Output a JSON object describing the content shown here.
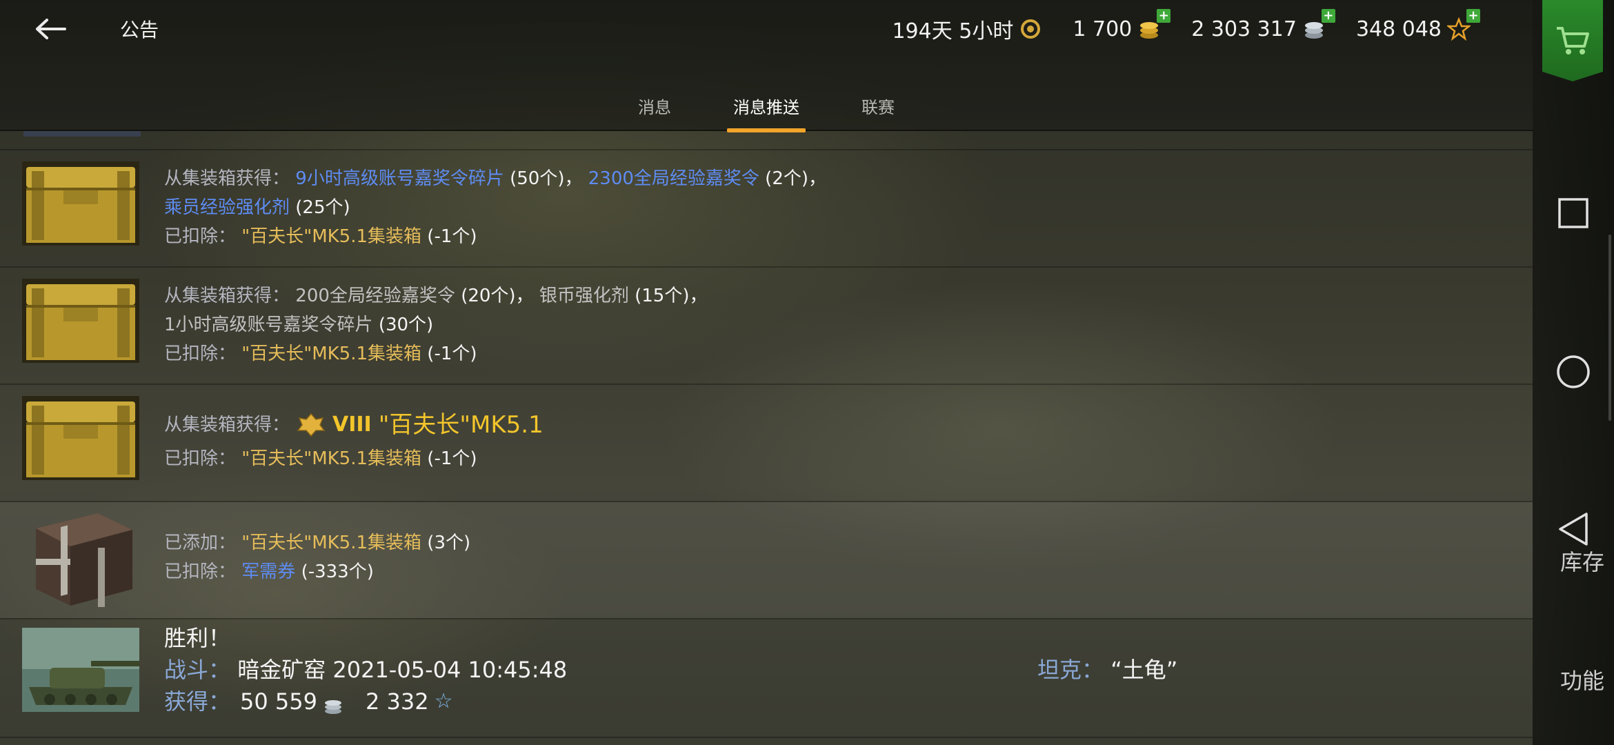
{
  "header": {
    "title": "公告",
    "currencies": [
      {
        "id": "premium",
        "value": "194天 5小时",
        "icon": "laurel-icon",
        "plus": false
      },
      {
        "id": "gold",
        "value": "1 700",
        "icon": "gold-coins-icon",
        "plus": true
      },
      {
        "id": "credits",
        "value": "2 303 317",
        "icon": "silver-coins-icon",
        "plus": true
      },
      {
        "id": "xp",
        "value": "348 048",
        "icon": "star-icon",
        "plus": true
      }
    ]
  },
  "tabs": [
    {
      "label": "消息",
      "active": false
    },
    {
      "label": "消息推送",
      "active": true
    },
    {
      "label": "联赛",
      "active": false
    }
  ],
  "rail": {
    "inventory": "库存",
    "functions": "功能"
  },
  "messages": [
    {
      "icon": "gold-container-icon",
      "line1_label": "从集装箱获得：",
      "line1_item1": "9小时高级账号嘉奖令碎片",
      "line1_count1": "(50个)，",
      "line1_item2": "2300全局经验嘉奖令",
      "line1_count2": "(2个)，",
      "line2_item": "乘员经验强化剂",
      "line2_count": "(25个)",
      "line3_label": "已扣除：",
      "line3_item": "\"百夫长\"MK5.1集装箱",
      "line3_count": "(-1个)"
    },
    {
      "icon": "gold-container-icon",
      "line1_label": "从集装箱获得：",
      "line1_item1": "200全局经验嘉奖令",
      "line1_count1": "(20个)，",
      "line1_item2": "银币强化剂",
      "line1_count2": "(15个)，",
      "line2_item": "1小时高级账号嘉奖令碎片",
      "line2_count": "(30个)",
      "line3_label": "已扣除：",
      "line3_item": "\"百夫长\"MK5.1集装箱",
      "line3_count": "(-1个)"
    },
    {
      "icon": "gold-container-icon",
      "line1_label": "从集装箱获得：",
      "tier": "VIII",
      "vehicle": "\"百夫长\"MK5.1",
      "line2_label": "已扣除：",
      "line2_item": "\"百夫长\"MK5.1集装箱",
      "line2_count": "(-1个)"
    },
    {
      "icon": "steel-container-icon",
      "line1_label": "已添加：",
      "line1_item": "\"百夫长\"MK5.1集装箱",
      "line1_count": "(3个)",
      "line2_label": "已扣除：",
      "line2_item": "军需券",
      "line2_count": "(-333个)"
    }
  ],
  "battle": {
    "title": "胜利！",
    "battle_label": "战斗：",
    "battle_value": "暗金矿窑 2021-05-04 10:45:48",
    "tank_label": "坦克：",
    "tank_value": "“土龟”",
    "reward_label": "获得：",
    "credits": "50 559",
    "xp": "2 332"
  },
  "colors": {
    "accent": "#f1a52a",
    "link_blue": "#5e8cf2",
    "gold_text": "#e6bd5a",
    "shop_green": "#2a8a2a"
  }
}
